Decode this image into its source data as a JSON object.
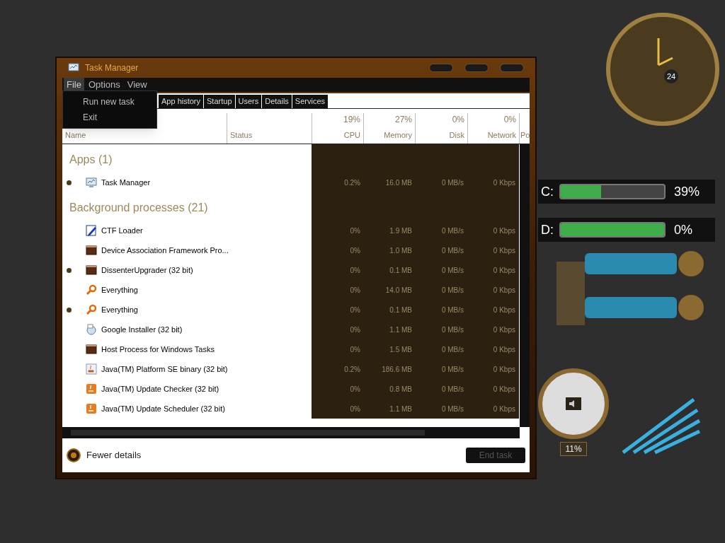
{
  "window": {
    "title": "Task Manager"
  },
  "menu": [
    {
      "label": "File",
      "selected": true
    },
    {
      "label": "Options",
      "selected": false
    },
    {
      "label": "View",
      "selected": false
    }
  ],
  "dropdown": [
    "Run new task",
    "Exit"
  ],
  "tabs": [
    {
      "label": "App history",
      "selected": false
    },
    {
      "label": "Startup",
      "selected": false
    },
    {
      "label": "Users",
      "selected": false
    },
    {
      "label": "Details",
      "selected": false
    },
    {
      "label": "Services",
      "selected": false
    }
  ],
  "columns": [
    {
      "label": "Name"
    },
    {
      "label": "Status"
    },
    {
      "label": "CPU",
      "summary": "19%"
    },
    {
      "label": "Memory",
      "summary": "27%"
    },
    {
      "label": "Disk",
      "summary": "0%"
    },
    {
      "label": "Network",
      "summary": "0%"
    },
    {
      "label": "Po"
    }
  ],
  "groups": [
    {
      "title": "Apps (1)",
      "rows": [
        {
          "name": "Task Manager",
          "kind": "monitor",
          "expandable": true,
          "cpu": "0.2%",
          "memory": "16.0 MB",
          "disk": "0 MB/s",
          "network": "0 Kbps"
        }
      ]
    },
    {
      "title": "Background processes (21)",
      "rows": [
        {
          "name": "CTF Loader",
          "kind": "notepad",
          "expandable": false,
          "cpu": "0%",
          "memory": "1.9 MB",
          "disk": "0 MB/s",
          "network": "0 Kbps"
        },
        {
          "name": "Device Association Framework Pro...",
          "kind": "window",
          "expandable": false,
          "cpu": "0%",
          "memory": "1.0 MB",
          "disk": "0 MB/s",
          "network": "0 Kbps"
        },
        {
          "name": "DissenterUpgrader (32 bit)",
          "kind": "window",
          "expandable": true,
          "cpu": "0%",
          "memory": "0.1 MB",
          "disk": "0 MB/s",
          "network": "0 Kbps"
        },
        {
          "name": "Everything",
          "kind": "magnifier",
          "expandable": false,
          "cpu": "0%",
          "memory": "14.0 MB",
          "disk": "0 MB/s",
          "network": "0 Kbps"
        },
        {
          "name": "Everything",
          "kind": "magnifier",
          "expandable": true,
          "cpu": "0%",
          "memory": "0.1 MB",
          "disk": "0 MB/s",
          "network": "0 Kbps"
        },
        {
          "name": "Google Installer (32 bit)",
          "kind": "installer",
          "expandable": false,
          "cpu": "0%",
          "memory": "1.1 MB",
          "disk": "0 MB/s",
          "network": "0 Kbps"
        },
        {
          "name": "Host Process for Windows Tasks",
          "kind": "window",
          "expandable": false,
          "cpu": "0%",
          "memory": "1.5 MB",
          "disk": "0 MB/s",
          "network": "0 Kbps"
        },
        {
          "name": "Java(TM) Platform SE binary (32 bit)",
          "kind": "java",
          "expandable": false,
          "cpu": "0.2%",
          "memory": "186.6 MB",
          "disk": "0 MB/s",
          "network": "0 Kbps"
        },
        {
          "name": "Java(TM) Update Checker (32 bit)",
          "kind": "java-orange",
          "expandable": false,
          "cpu": "0%",
          "memory": "0.8 MB",
          "disk": "0 MB/s",
          "network": "0 Kbps"
        },
        {
          "name": "Java(TM) Update Scheduler (32 bit)",
          "kind": "java-orange",
          "expandable": false,
          "cpu": "0%",
          "memory": "1.1 MB",
          "disk": "0 MB/s",
          "network": "0 Kbps"
        }
      ]
    }
  ],
  "footer": {
    "toggle": "Fewer details",
    "end_task": "End task",
    "end_task_disabled": true
  },
  "clock": {
    "dial_label": "24"
  },
  "drives": [
    {
      "label": "C:",
      "level": 0.39,
      "reading": "39%"
    },
    {
      "label": "D:",
      "level": 1,
      "reading": "0%"
    }
  ],
  "gauge": {
    "reading": "11%"
  }
}
